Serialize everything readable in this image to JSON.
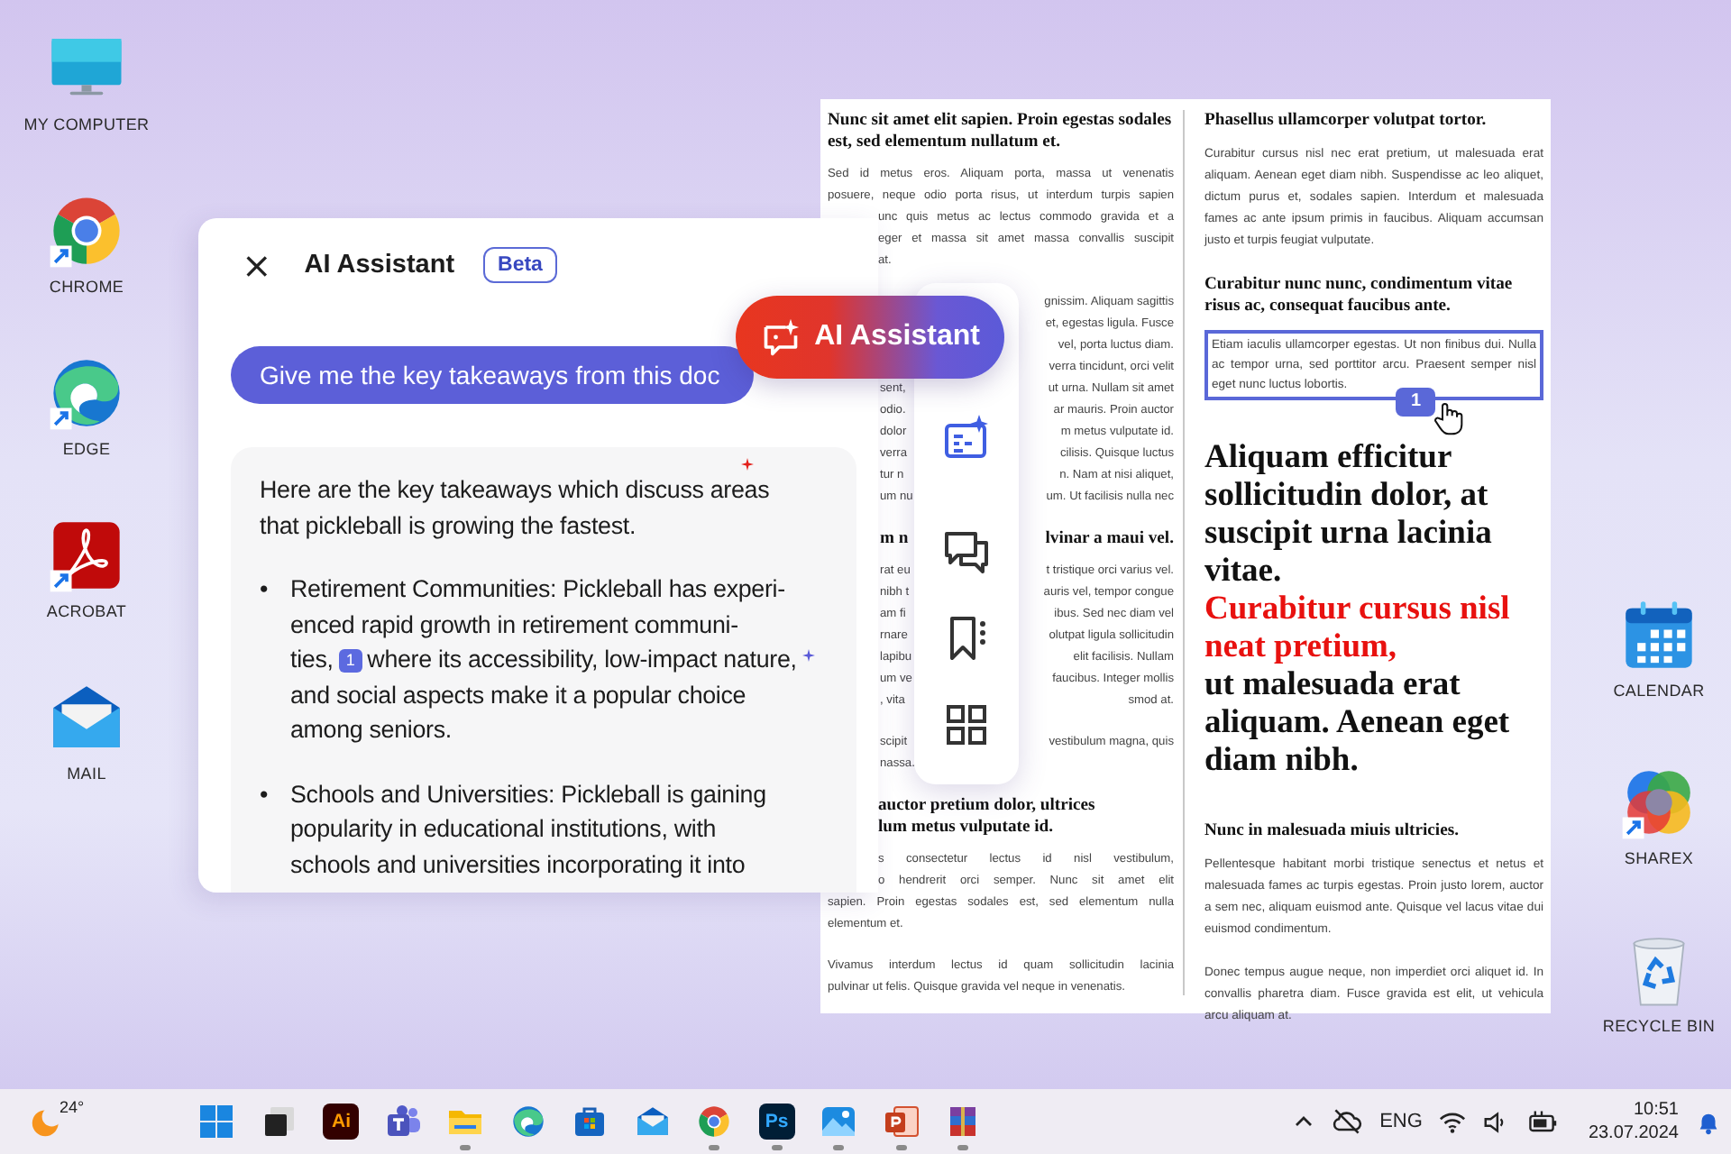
{
  "desktop_icons_left": [
    {
      "kind": "computer",
      "label": "MY COMPUTER",
      "shortcut": false
    },
    {
      "kind": "chrome",
      "label": "CHROME",
      "shortcut": true
    },
    {
      "kind": "edge",
      "label": "EDGE",
      "shortcut": true
    },
    {
      "kind": "acrobat",
      "label": "ACROBAT",
      "shortcut": true
    },
    {
      "kind": "mail",
      "label": "MAIL",
      "shortcut": false
    }
  ],
  "desktop_icons_right": [
    {
      "kind": "calendar",
      "label": "CALENDAR",
      "shortcut": false
    },
    {
      "kind": "sharex",
      "label": "SHAREX",
      "shortcut": true
    },
    {
      "kind": "recycle",
      "label": "RECYCLE BIN",
      "shortcut": false
    }
  ],
  "document": {
    "columns": [
      {
        "blocks": [
          {
            "kind": "heading",
            "text": "Nunc sit amet elit sapien. Proin egestas sodales est, sed elementum nullatum et."
          },
          {
            "kind": "paragraph",
            "lines": [
              {
                "text": "Sed id metus eros. Aliquam porta, massa ut venenatis",
                "covered": false
              },
              {
                "text": "posuere, neque odio porta risus, ut interdum turpis sapien",
                "covered": false
              },
              {
                "text": "unc quis metus ac lectus commodo gravida et a",
                "covered": true
              },
              {
                "text": "eger et massa sit amet massa convallis suscipit",
                "covered": true
              },
              {
                "text": "at.",
                "covered": true
              }
            ]
          },
          {
            "kind": "paragraph",
            "lines": [
              {
                "right": "gnissim. Aliquam sagittis"
              },
              {
                "right": "et, egestas ligula. Fusce"
              },
              {
                "right": "vel, porta luctus diam."
              },
              {
                "right": "verra tincidunt, orci velit"
              },
              {
                "left": "sent,",
                "right": "ut urna. Nullam sit amet"
              },
              {
                "left": "odio.",
                "right": "ar mauris. Proin auctor"
              },
              {
                "left": "dolor",
                "right": "m metus vulputate id."
              },
              {
                "left": "verra",
                "right": "cilisis. Quisque luctus"
              },
              {
                "left": "tur n",
                "right": "n. Nam at nisi aliquet,"
              },
              {
                "left": "um nu",
                "right": "um. Ut facilisis nulla nec"
              }
            ]
          },
          {
            "kind": "heading",
            "lines": [
              {
                "left": "m n",
                "right": "lvinar a maui vel."
              }
            ]
          },
          {
            "kind": "paragraph",
            "lines": [
              {
                "left": "rat eu",
                "right": "t tristique orci varius vel."
              },
              {
                "left": "nibh t",
                "right": "auris vel, tempor congue"
              },
              {
                "left": "am fi",
                "right": "ibus. Sed nec diam vel"
              },
              {
                "left": "rnare",
                "right": "olutpat ligula sollicitudin"
              },
              {
                "left": "lapibu",
                "right": "elit facilisis. Nullam"
              },
              {
                "left": "um ve",
                "right": "faucibus. Integer mollis"
              },
              {
                "left": ", vita",
                "right": "smod at."
              }
            ]
          },
          {
            "kind": "paragraph",
            "lines": [
              {
                "left": "scipit",
                "right": "vestibulum magna, quis"
              },
              {
                "left": "nassa."
              }
            ]
          },
          {
            "kind": "heading",
            "lines": [
              {
                "text": "auctor pretium dolor, ultrices",
                "covered": true
              },
              {
                "text": "lum metus vulputate id.",
                "covered": true
              }
            ]
          },
          {
            "kind": "paragraph",
            "lines": [
              {
                "text": "s consectetur lectus id nisl vestibulum,",
                "covered": true
              },
              {
                "text": "o hendrerit orci semper. Nunc sit amet elit",
                "covered": true
              },
              {
                "text": "sapien. Proin egestas sodales est, sed elementum nulla",
                "covered": false
              },
              {
                "text": "elementum et.",
                "covered": false
              }
            ]
          },
          {
            "kind": "paragraph",
            "lines": [
              {
                "text": "Vivamus interdum lectus id quam sollicitudin lacinia",
                "covered": false
              },
              {
                "text": "pulvinar ut felis. Quisque gravida vel neque in venenatis.",
                "covered": false
              }
            ]
          }
        ]
      },
      {
        "blocks": [
          {
            "kind": "heading",
            "text": "Phasellus ullamcorper volutpat tortor."
          },
          {
            "kind": "paragraph",
            "highlighted": false,
            "text": "Curabitur cursus nisl nec erat pretium, ut malesuada erat aliquam. Aenean eget diam nibh. Suspendisse ac leo aliquet, dictum purus et, sodales sapien. Interdum et malesuada fames ac ante ipsum primis in faucibus. Aliquam accumsan justo et turpis feugiat vulputate."
          },
          {
            "kind": "heading",
            "text": "Curabitur nunc nunc, condimentum vitae risus ac, consequat faucibus ante."
          },
          {
            "kind": "paragraph",
            "highlighted": true,
            "citation": "1",
            "text": "Etiam iaculis ullamcorper egestas. Ut non finibus dui. Nulla ac tempor urna, sed porttitor arcu. Praesent semper nisl eget nunc luctus lobortis."
          },
          {
            "kind": "display",
            "segments": [
              {
                "text": "Aliquam efficitur sollicitudin dolor, at suscipit urna lacinia vitae.",
                "emphasis": false
              },
              {
                "text": "Curabitur cursus nisl neat pretium,",
                "emphasis": true
              },
              {
                "text": "ut malesuada erat aliquam. Aenean eget diam nibh.",
                "emphasis": false
              }
            ]
          },
          {
            "kind": "heading",
            "text": "Nunc in malesuada miuis ultricies."
          },
          {
            "kind": "paragraph",
            "highlighted": false,
            "text": "Pellentesque habitant morbi tristique senectus et netus et malesuada fames ac turpis egestas. Proin justo lorem, auctor a sem nec, aliquam euismod ante. Quisque vel lacus vitae dui euismod condimentum."
          },
          {
            "kind": "paragraph",
            "highlighted": false,
            "text": "Donec tempus augue neque, non imperdiet orci aliquet id. In convallis pharetra diam. Fusce gravida est elit, ut vehicula arcu aliquam at."
          }
        ]
      }
    ]
  },
  "ai_panel": {
    "close": "×",
    "title": "AI Assistant",
    "badge": "Beta",
    "prompt": "Give me the key takeaways from this doc",
    "response": {
      "intro": [
        "Here are the key takeaways which discuss areas",
        "that pickleball is growing the fastest."
      ],
      "bullets": [
        {
          "marker": "•",
          "lines": [
            {
              "text": "Retirement Communities: Pickleball has experi-"
            },
            {
              "text": "enced rapid growth in retirement communi-"
            },
            {
              "text": "ties,",
              "citation": "1",
              "after": "where its accessibility, low-impact nature,"
            },
            {
              "text": "and social aspects make it a popular choice"
            },
            {
              "text": "among seniors."
            }
          ]
        },
        {
          "marker": "•",
          "lines": [
            {
              "text": "Schools and Universities: Pickleball is gaining"
            },
            {
              "text": "popularity in educational institutions, with"
            },
            {
              "text": "schools and universities incorporating it into"
            }
          ]
        }
      ]
    }
  },
  "ai_button": {
    "label": "AI Assistant"
  },
  "toolbar": {
    "items": [
      {
        "kind": "ai",
        "selected": true
      },
      {
        "kind": "comment",
        "selected": false
      },
      {
        "kind": "bookmark",
        "selected": false
      },
      {
        "kind": "grid",
        "selected": false
      }
    ]
  },
  "taskbar": {
    "weather": {
      "temperature": "24°"
    },
    "apps": [
      {
        "kind": "start",
        "running": false
      },
      {
        "kind": "taskview",
        "running": false
      },
      {
        "kind": "illustrator",
        "label": "Ai",
        "running": false
      },
      {
        "kind": "teams",
        "running": false
      },
      {
        "kind": "explorer",
        "running": true
      },
      {
        "kind": "edge",
        "running": false
      },
      {
        "kind": "store",
        "running": false
      },
      {
        "kind": "mail",
        "running": false
      },
      {
        "kind": "chrome",
        "running": true
      },
      {
        "kind": "photoshop",
        "label": "Ps",
        "running": true
      },
      {
        "kind": "photos",
        "running": true
      },
      {
        "kind": "powerpoint",
        "running": true
      },
      {
        "kind": "winrar",
        "running": true
      }
    ],
    "tray": {
      "language": "ENG",
      "time": "10:51",
      "date": "23.07.2024"
    }
  }
}
